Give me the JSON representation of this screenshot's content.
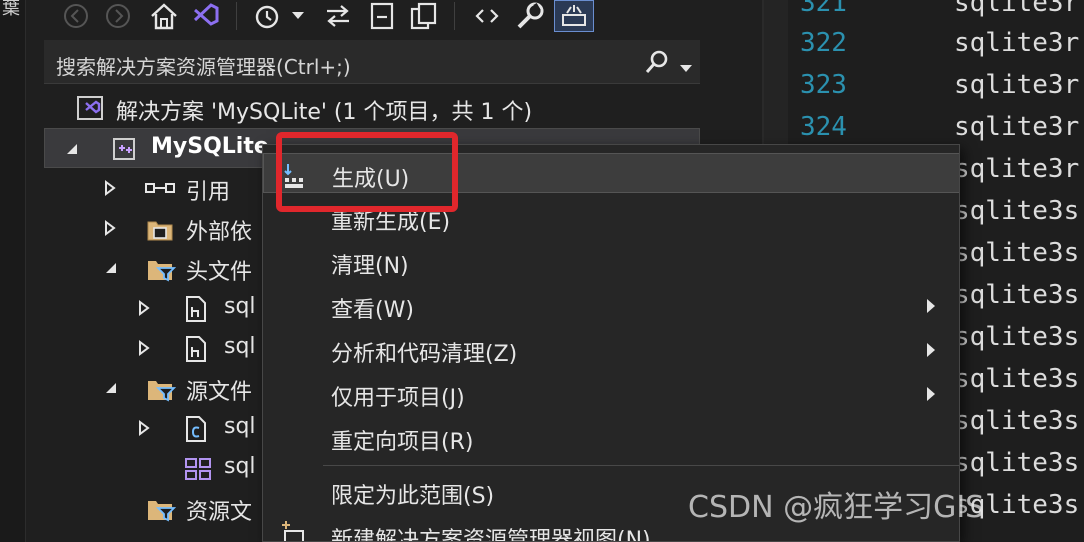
{
  "left_strip": {
    "glyph": "葉"
  },
  "toolbar": {
    "buttons": [
      "back-icon",
      "forward-icon",
      "home-icon",
      "vs-icon",
      "history-icon",
      "dropdown-icon",
      "sync-icon",
      "collapse-icon",
      "copy-icon",
      "code-icon",
      "wrench-icon",
      "preview-icon"
    ]
  },
  "search": {
    "placeholder": "搜索解决方案资源管理器(Ctrl+;)"
  },
  "tree": {
    "solution": "解决方案 'MySQLite' (1 个项目，共 1 个)",
    "project": "MySQLite",
    "items": [
      {
        "label": "引用",
        "icon": "references-icon"
      },
      {
        "label": "外部依",
        "icon": "external-deps-icon"
      },
      {
        "label": "头文件",
        "icon": "folder-filter-icon"
      },
      {
        "label": "sql",
        "icon": "header-file-icon"
      },
      {
        "label": "sql",
        "icon": "header-file-icon"
      },
      {
        "label": "源文件",
        "icon": "folder-filter-icon"
      },
      {
        "label": "sql",
        "icon": "c-file-icon"
      },
      {
        "label": "sql",
        "icon": "def-file-icon"
      },
      {
        "label": "资源文",
        "icon": "folder-filter-icon"
      }
    ]
  },
  "code": {
    "lines": [
      {
        "num": "321",
        "text": "sqlite3r"
      },
      {
        "num": "322",
        "text": "sqlite3r"
      },
      {
        "num": "323",
        "text": "sqlite3r"
      },
      {
        "num": "324",
        "text": "sqlite3r"
      },
      {
        "num": "",
        "text": "sqlite3r"
      },
      {
        "num": "",
        "text": "sqlite3s"
      },
      {
        "num": "",
        "text": "sqlite3s"
      },
      {
        "num": "",
        "text": "sqlite3s"
      },
      {
        "num": "",
        "text": "sqlite3s"
      },
      {
        "num": "",
        "text": "sqlite3s"
      },
      {
        "num": "",
        "text": "sqlite3s"
      },
      {
        "num": "",
        "text": "sqlite3s"
      },
      {
        "num": "",
        "text": "sqlite3s"
      }
    ]
  },
  "context_menu": {
    "items": [
      {
        "label": "生成(U)",
        "has_submenu": false,
        "icon": "build-icon"
      },
      {
        "label": "重新生成(E)",
        "has_submenu": false
      },
      {
        "label": "清理(N)",
        "has_submenu": false
      },
      {
        "label": "查看(W)",
        "has_submenu": true
      },
      {
        "label": "分析和代码清理(Z)",
        "has_submenu": true
      },
      {
        "label": "仅用于项目(J)",
        "has_submenu": true
      },
      {
        "label": "重定向项目(R)",
        "has_submenu": false
      },
      {
        "label": "限定为此范围(S)",
        "has_submenu": false
      },
      {
        "label": "新建解决方案资源管理器视图(N)",
        "has_submenu": false,
        "icon": "new-view-icon"
      }
    ]
  },
  "watermark": "CSDN @疯狂学习GIS",
  "colors": {
    "highlight": "#e0272c",
    "line_number": "#2b91af",
    "accent": "#6a8ed0"
  }
}
